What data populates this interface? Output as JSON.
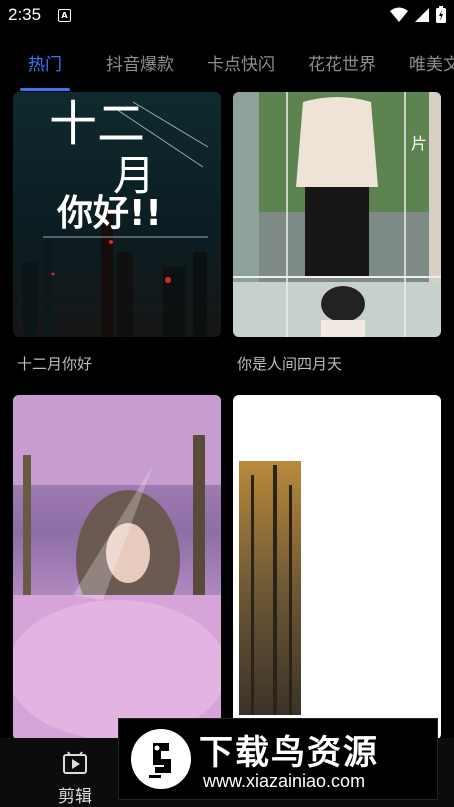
{
  "status_bar": {
    "time": "2:35",
    "notification_glyph": "A"
  },
  "tabs": [
    {
      "label": "热门",
      "active": true
    },
    {
      "label": "抖音爆款"
    },
    {
      "label": "卡点快闪"
    },
    {
      "label": "花花世界"
    },
    {
      "label": "唯美文"
    }
  ],
  "templates": [
    {
      "caption": "十二月你好",
      "art_text_top": "十二",
      "art_text_month": "月",
      "art_text_main": "你好!!"
    },
    {
      "caption": "你是人间四月天",
      "art_text": "片"
    },
    {
      "caption": ""
    },
    {
      "caption": ""
    }
  ],
  "bottom_nav": {
    "edit_label": "剪辑"
  },
  "watermark": {
    "title": "下载鸟资源",
    "url": "www.xiazainiao.com"
  },
  "colors": {
    "accent": "#3a78f2",
    "background": "#000000",
    "inactive_tab": "#8e8e8e"
  }
}
